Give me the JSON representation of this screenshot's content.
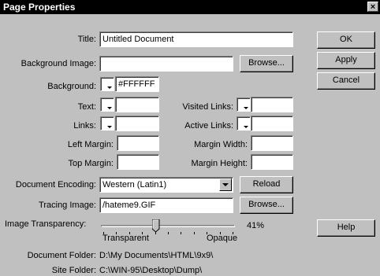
{
  "window": {
    "title": "Page Properties",
    "close_label": "×"
  },
  "fields": {
    "title": {
      "label": "Title:",
      "value": "Untitled Document"
    },
    "background_image": {
      "label": "Background Image:",
      "value": "",
      "browse_label": "Browse..."
    },
    "background": {
      "label": "Background:",
      "color_text": "#FFFFFF",
      "color": "#FFFFFF"
    },
    "text": {
      "label": "Text:",
      "value": ""
    },
    "visited_links": {
      "label": "Visited Links:",
      "value": ""
    },
    "links": {
      "label": "Links:",
      "value": ""
    },
    "active_links": {
      "label": "Active Links:",
      "value": ""
    },
    "left_margin": {
      "label": "Left Margin:",
      "value": ""
    },
    "margin_width": {
      "label": "Margin Width:",
      "value": ""
    },
    "top_margin": {
      "label": "Top Margin:",
      "value": ""
    },
    "margin_height": {
      "label": "Margin Height:",
      "value": ""
    },
    "document_encoding": {
      "label": "Document Encoding:",
      "value": "Western (Latin1)",
      "reload_label": "Reload"
    },
    "tracing_image": {
      "label": "Tracing Image:",
      "value": "/hateme9.GIF",
      "browse_label": "Browse..."
    },
    "image_transparency": {
      "label": "Image Transparency:",
      "value_text": "41%",
      "value": 0.41,
      "min_label": "Transparent",
      "max_label": "Opaque"
    },
    "document_folder": {
      "label": "Document Folder:",
      "value": "D:\\My Documents\\HTML\\9x9\\"
    },
    "site_folder": {
      "label": "Site Folder:",
      "value": "C:\\WIN-95\\Desktop\\Dump\\"
    }
  },
  "buttons": {
    "ok": "OK",
    "apply": "Apply",
    "cancel": "Cancel",
    "help": "Help"
  }
}
